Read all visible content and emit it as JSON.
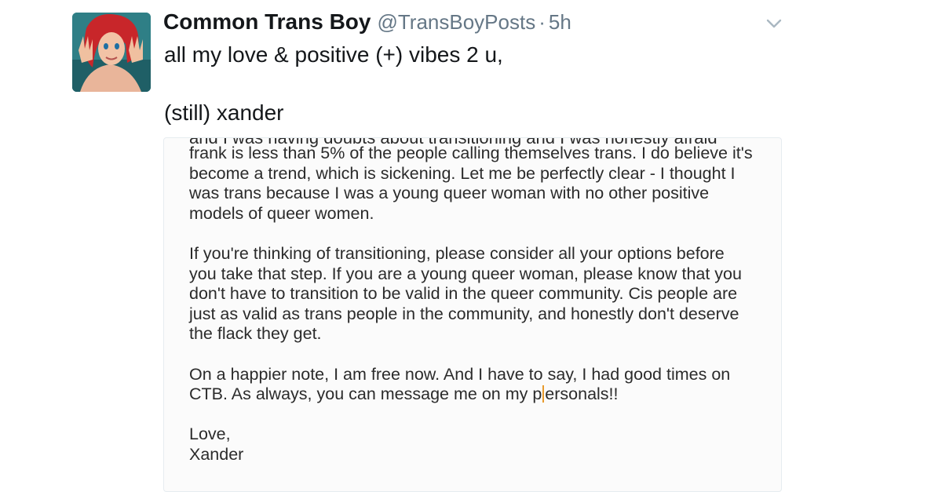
{
  "tweet": {
    "display_name": "Common Trans Boy",
    "handle": "@TransBoyPosts",
    "separator": "·",
    "time": "5h",
    "text_line1": "all my love & positive (+) vibes 2 u,",
    "text_line2": "(still) xander"
  },
  "icons": {
    "avatar": "cartoon-mermaid-avatar",
    "menu": "chevron-down-icon"
  },
  "colors": {
    "secondary_text": "#657786",
    "primary_text": "#14171a",
    "card_border": "#e6ecf0",
    "cursor": "#e89a2c"
  },
  "letter": {
    "cut_line": "and I was having doubts about transitioning and I was honestly afraid",
    "p1_l1": "frank is less than 5% of the people calling themselves trans. I do believe it's",
    "p1_l2": "become a trend, which is sickening. Let me be perfectly clear - I thought I",
    "p1_l3": "was trans because I was a young queer woman with no other positive",
    "p1_l4": "models of queer women.",
    "p2_l1": "If you're thinking of transitioning,  please consider all your options before",
    "p2_l2": "you take that step. If you are a young queer woman, please know that you",
    "p2_l3": "don't have to transition to be valid in the queer community. Cis people are",
    "p2_l4": "just as valid as trans people in the community, and honestly don't deserve",
    "p2_l5": "the flack they get.",
    "p3_l1": "On a happier note, I am free now. And I have to say, I had good times on",
    "p3_l2_a": "CTB. As always, you can message me on my p",
    "p3_l2_b": "ersonals!!",
    "sign_l1": "Love,",
    "sign_l2": "Xander"
  }
}
